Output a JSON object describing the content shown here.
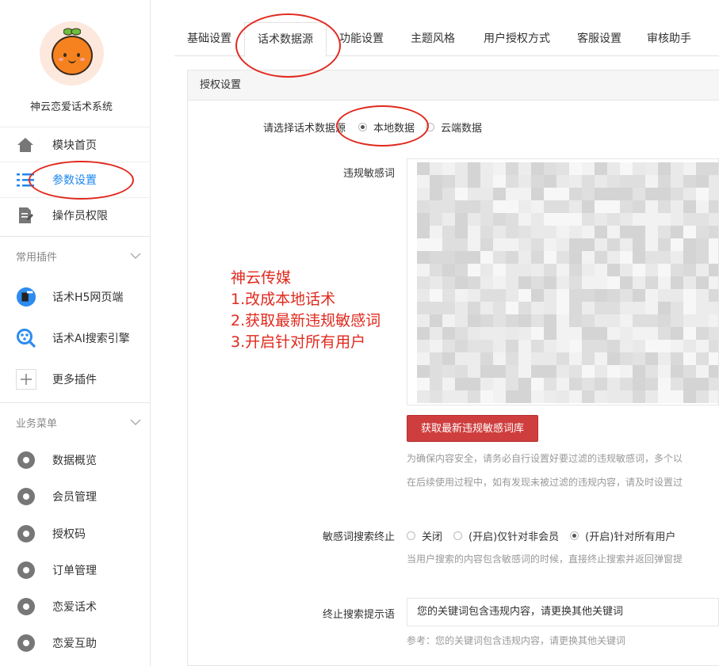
{
  "app": {
    "name": "神云恋爱话术系统"
  },
  "sidebar": {
    "main_items": [
      {
        "label": "模块首页",
        "icon": "home-icon"
      },
      {
        "label": "参数设置",
        "icon": "menu-lines-icon",
        "active": true
      },
      {
        "label": "操作员权限",
        "icon": "edit-doc-icon"
      }
    ],
    "plugins_title": "常用插件",
    "plugins": [
      {
        "label": "话术H5网页端",
        "icon": "h5-page-icon"
      },
      {
        "label": "话术AI搜索引擎",
        "icon": "ai-search-icon"
      },
      {
        "label": "更多插件",
        "icon": "plus-icon"
      }
    ],
    "business_title": "业务菜单",
    "business": [
      {
        "label": "数据概览",
        "icon": "gear-icon"
      },
      {
        "label": "会员管理",
        "icon": "gear-icon"
      },
      {
        "label": "授权码",
        "icon": "gear-icon"
      },
      {
        "label": "订单管理",
        "icon": "gear-icon"
      },
      {
        "label": "恋爱话术",
        "icon": "gear-icon"
      },
      {
        "label": "恋爱互助",
        "icon": "gear-icon"
      }
    ]
  },
  "tabs": [
    "基础设置",
    "话术数据源",
    "功能设置",
    "主题风格",
    "用户授权方式",
    "客服设置",
    "审核助手"
  ],
  "active_tab": "话术数据源",
  "panel": {
    "title": "授权设置",
    "source_label": "请选择话术数据源",
    "source_options": [
      "本地数据",
      "云端数据"
    ],
    "source_selected": "本地数据",
    "words_label": "违规敏感词",
    "fetch_button": "获取最新违规敏感词库",
    "hint1": "为确保内容安全，请务必自行设置好要过滤的违规敏感词，多个以",
    "hint2": "在后续使用过程中，如有发现未被过滤的违规内容，请及时设置过",
    "stop_label": "敏感词搜索终止",
    "stop_options": [
      "关闭",
      "(开启)仅针对非会员",
      "(开启)针对所有用户"
    ],
    "stop_selected": "(开启)针对所有用户",
    "stop_hint": "当用户搜索的内容包含敏感词的时候，直接终止搜索并返回弹窗提",
    "tip_label": "终止搜索提示语",
    "tip_value": "您的关键词包含违规内容，请更换其他关键词",
    "tip_ref": "参考：您的关键词包含违规内容，请更换其他关键词"
  },
  "annotation": {
    "lines": [
      "神云传媒",
      "1.改成本地话术",
      "2.获取最新违规敏感词",
      "3.开启针对所有用户"
    ],
    "color": "#e02a1f"
  },
  "colors": {
    "accent": "#1e87f0",
    "button_red": "#cf3e3e"
  }
}
